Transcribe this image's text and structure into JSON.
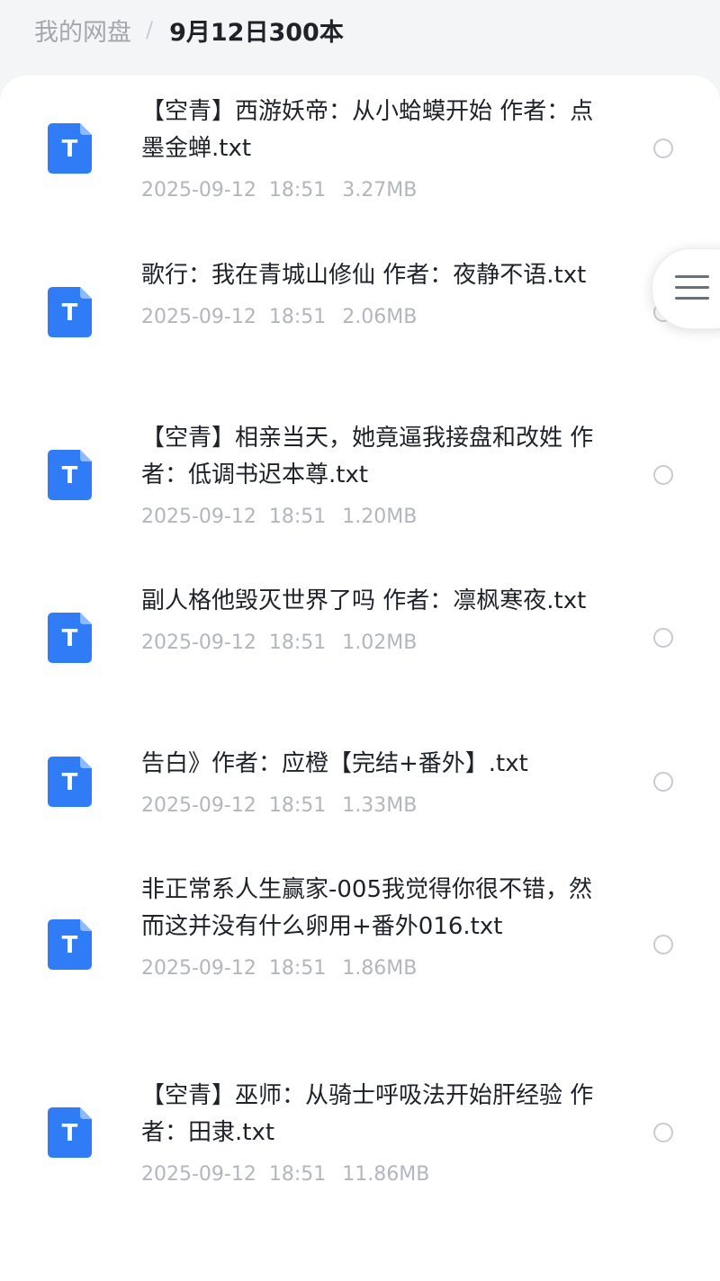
{
  "breadcrumb": {
    "root": "我的网盘",
    "separator": "/",
    "current": "9月12日300本"
  },
  "colors": {
    "icon_blue": "#2f7cf6",
    "meta_gray": "#b3b6bc",
    "breadcrumb_gray": "#a3a7ae"
  },
  "file_icon": {
    "glyph": "T",
    "icon": "txt-file-icon"
  },
  "float_menu": {
    "icon": "hamburger-menu-icon"
  },
  "files": [
    {
      "name": "【空青】西游妖帝：从小蛤蟆开始 作者：点墨金蝉.txt",
      "date": "2025-09-12",
      "time": "18:51",
      "size": "3.27MB",
      "selected": false
    },
    {
      "name": "歌行：我在青城山修仙 作者：夜静不语.txt",
      "date": "2025-09-12",
      "time": "18:51",
      "size": "2.06MB",
      "selected": false
    },
    {
      "name": "【空青】相亲当天，她竟逼我接盘和改姓 作者：低调书迟本尊.txt",
      "date": "2025-09-12",
      "time": "18:51",
      "size": "1.20MB",
      "selected": false
    },
    {
      "name": "副人格他毁灭世界了吗 作者：凛枫寒夜.txt",
      "date": "2025-09-12",
      "time": "18:51",
      "size": "1.02MB",
      "selected": false
    },
    {
      "name": "告白》作者：应橙【完结+番外】.txt",
      "date": "2025-09-12",
      "time": "18:51",
      "size": "1.33MB",
      "selected": false
    },
    {
      "name": "非正常系人生赢家-005我觉得你很不错，然而这并没有什么卵用+番外016.txt",
      "date": "2025-09-12",
      "time": "18:51",
      "size": "1.86MB",
      "selected": false
    },
    {
      "name": "【空青】巫师：从骑士呼吸法开始肝经验 作者：田隶.txt",
      "date": "2025-09-12",
      "time": "18:51",
      "size": "11.86MB",
      "selected": false
    }
  ]
}
